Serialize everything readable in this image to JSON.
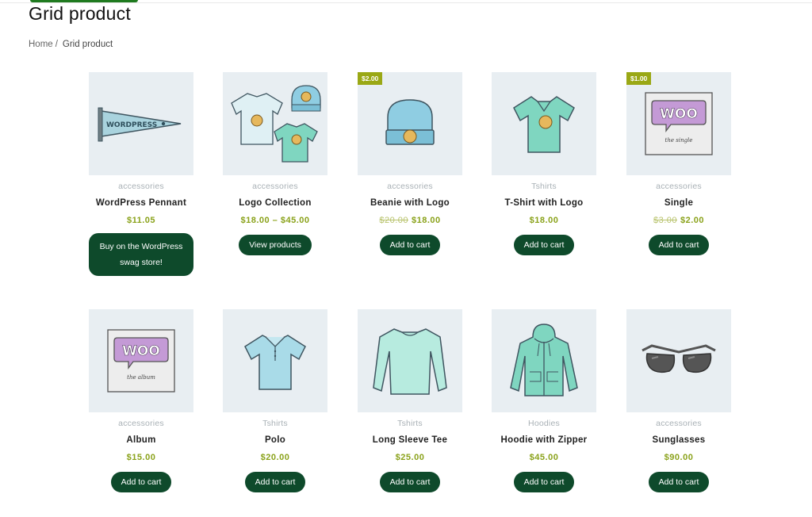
{
  "page": {
    "title": "Grid product",
    "breadcrumb": {
      "home": "Home",
      "separator": "/",
      "current": "Grid product"
    }
  },
  "colors": {
    "accent_green": "#0e4a2b",
    "price_green": "#8aa21a",
    "badge": "#9aa815",
    "thumb_bg": "#e8eef2"
  },
  "products": [
    {
      "name": "WordPress Pennant",
      "category": "accessories",
      "price": "$11.05",
      "old_price": null,
      "sale_badge": null,
      "button": "Buy on the WordPress swag store!",
      "icon": "pennant-icon"
    },
    {
      "name": "Logo Collection",
      "category": "accessories",
      "price": "$18.00 – $45.00",
      "old_price": null,
      "sale_badge": null,
      "button": "View products",
      "icon": "logo-collection-icon"
    },
    {
      "name": "Beanie with Logo",
      "category": "accessories",
      "price": "$18.00",
      "old_price": "$20.00",
      "sale_badge": "$2.00",
      "button": "Add to cart",
      "icon": "beanie-icon"
    },
    {
      "name": "T-Shirt with Logo",
      "category": "Tshirts",
      "price": "$18.00",
      "old_price": null,
      "sale_badge": null,
      "button": "Add to cart",
      "icon": "tshirt-icon"
    },
    {
      "name": "Single",
      "category": "accessories",
      "price": "$2.00",
      "old_price": "$3.00",
      "sale_badge": "$1.00",
      "button": "Add to cart",
      "icon": "woo-single-icon"
    },
    {
      "name": "Album",
      "category": "accessories",
      "price": "$15.00",
      "old_price": null,
      "sale_badge": null,
      "button": "Add to cart",
      "icon": "woo-album-icon"
    },
    {
      "name": "Polo",
      "category": "Tshirts",
      "price": "$20.00",
      "old_price": null,
      "sale_badge": null,
      "button": "Add to cart",
      "icon": "polo-icon"
    },
    {
      "name": "Long Sleeve Tee",
      "category": "Tshirts",
      "price": "$25.00",
      "old_price": null,
      "sale_badge": null,
      "button": "Add to cart",
      "icon": "long-sleeve-icon"
    },
    {
      "name": "Hoodie with Zipper",
      "category": "Hoodies",
      "price": "$45.00",
      "old_price": null,
      "sale_badge": null,
      "button": "Add to cart",
      "icon": "hoodie-icon"
    },
    {
      "name": "Sunglasses",
      "category": "accessories",
      "price": "$90.00",
      "old_price": null,
      "sale_badge": null,
      "button": "Add to cart",
      "icon": "sunglasses-icon"
    }
  ],
  "illustrations": {
    "woo_single": {
      "brand": "WOO",
      "caption": "the single"
    },
    "woo_album": {
      "brand": "WOO",
      "caption": "the album"
    },
    "pennant": {
      "text": "WORDPRESS"
    }
  }
}
